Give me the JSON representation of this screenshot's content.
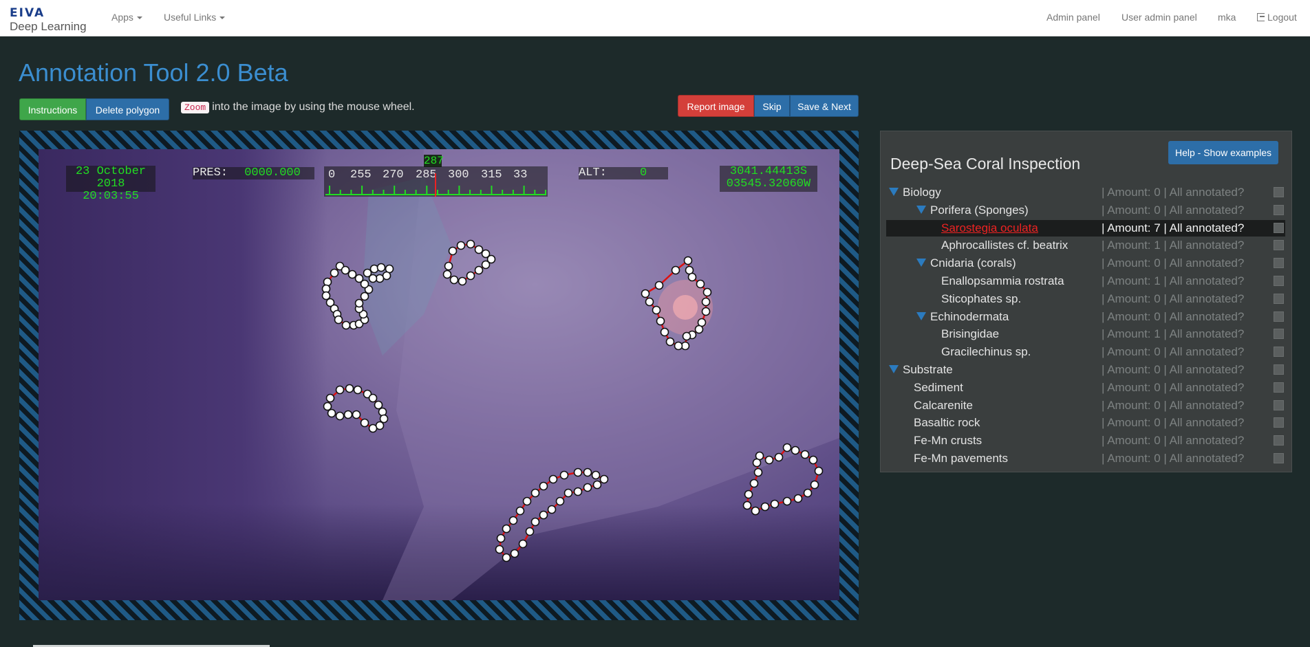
{
  "nav": {
    "brand_logo": "EIVA",
    "brand_sub": "Deep Learning",
    "apps": "Apps",
    "useful_links": "Useful Links",
    "admin_panel": "Admin panel",
    "user_admin_panel": "User admin panel",
    "user": "mka",
    "logout": "Logout"
  },
  "page": {
    "title": "Annotation Tool 2.0 Beta"
  },
  "toolbar": {
    "instructions": "Instructions",
    "delete_polygon": "Delete polygon",
    "zoom_code": "Zoom",
    "zoom_hint": "into the image by using the mouse wheel.",
    "report_image": "Report image",
    "skip": "Skip",
    "save_next": "Save & Next"
  },
  "overlay": {
    "date": "23 October 2018",
    "time": "20:03:55",
    "pres_label": "PRES:",
    "pres_value": "0000.000",
    "heading_value": "287",
    "heading_ticks": [
      "0",
      "255",
      "270",
      "285",
      "300",
      "315",
      "33"
    ],
    "alt_label": "ALT:",
    "alt_value": "0",
    "lat": "3041.44413S",
    "lon": "03545.32060W"
  },
  "panel": {
    "title": "Deep-Sea Coral Inspection",
    "help_button": "Help - Show examples",
    "status_template": "| Amount: {n} | All annotated?",
    "nodes": [
      {
        "label": "Biology",
        "status": "| Amount: 0 | All annotated?",
        "level": 0,
        "toggle": true
      },
      {
        "label": "Porifera (Sponges)",
        "status": "| Amount: 0 | All annotated?",
        "level": 1,
        "toggle": true
      },
      {
        "label": "Sarostegia oculata",
        "status": "| Amount: 7 | All annotated?",
        "level": 2,
        "toggle": false,
        "selected": true
      },
      {
        "label": "Aphrocallistes cf. beatrix",
        "status": "| Amount: 1 | All annotated?",
        "level": 2,
        "toggle": false
      },
      {
        "label": "Cnidaria (corals)",
        "status": "| Amount: 0 | All annotated?",
        "level": 1,
        "toggle": true
      },
      {
        "label": "Enallopsammia rostrata",
        "status": "| Amount: 1 | All annotated?",
        "level": 2,
        "toggle": false
      },
      {
        "label": "Sticophates sp.",
        "status": "| Amount: 0 | All annotated?",
        "level": 2,
        "toggle": false
      },
      {
        "label": "Echinodermata",
        "status": "| Amount: 0 | All annotated?",
        "level": 1,
        "toggle": true
      },
      {
        "label": "Brisingidae",
        "status": "| Amount: 1 | All annotated?",
        "level": 2,
        "toggle": false
      },
      {
        "label": "Gracilechinus sp.",
        "status": "| Amount: 0 | All annotated?",
        "level": 2,
        "toggle": false
      },
      {
        "label": "Substrate",
        "status": "| Amount: 0 | All annotated?",
        "level": 0,
        "toggle": true
      },
      {
        "label": "Sediment",
        "status": "| Amount: 0 | All annotated?",
        "level": 1,
        "toggle": false
      },
      {
        "label": "Calcarenite",
        "status": "| Amount: 0 | All annotated?",
        "level": 1,
        "toggle": false
      },
      {
        "label": "Basaltic rock",
        "status": "| Amount: 0 | All annotated?",
        "level": 1,
        "toggle": false
      },
      {
        "label": "Fe-Mn crusts",
        "status": "| Amount: 0 | All annotated?",
        "level": 1,
        "toggle": false
      },
      {
        "label": "Fe-Mn pavements",
        "status": "| Amount: 0 | All annotated?",
        "level": 1,
        "toggle": false
      }
    ]
  },
  "colors": {
    "accent": "#3b8ed0",
    "selected_label": "#ee2222",
    "polygon_edge": "#dd1111",
    "osd_green": "#22dd22"
  }
}
